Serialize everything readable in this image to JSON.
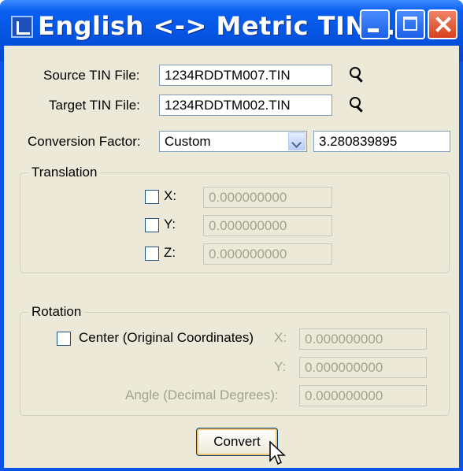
{
  "window": {
    "title": "English <-> Metric TIN ...",
    "buttons": {
      "minimize": "minimize-icon",
      "maximize": "maximize-icon",
      "close": "close-icon"
    }
  },
  "form": {
    "source_label": "Source TIN File:",
    "source_value": "1234RDDTM007.TIN",
    "target_label": "Target TIN File:",
    "target_value": "1234RDDTM002.TIN",
    "conversion_label": "Conversion Factor:",
    "conversion_selected": "Custom",
    "conversion_value": "3.280839895"
  },
  "translation": {
    "legend": "Translation",
    "rows": [
      {
        "label": "X:",
        "value": "0.000000000"
      },
      {
        "label": "Y:",
        "value": "0.000000000"
      },
      {
        "label": "Z:",
        "value": "0.000000000"
      }
    ]
  },
  "rotation": {
    "legend": "Rotation",
    "center_label": "Center (Original Coordinates)",
    "x_label": "X:",
    "x_value": "0.000000000",
    "y_label": "Y:",
    "y_value": "0.000000000",
    "angle_label": "Angle (Decimal Degrees):",
    "angle_value": "0.000000000"
  },
  "actions": {
    "convert_label": "Convert"
  },
  "colors": {
    "titlebar": "#0553e0",
    "client": "#ece9d8",
    "close": "#d8401c"
  }
}
